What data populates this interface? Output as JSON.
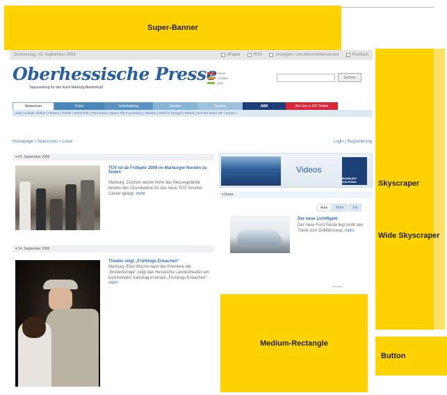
{
  "ads": {
    "super_banner": "Super-Banner",
    "skyscraper": "Skyscraper",
    "wide_skyscraper": "Wide Skyscraper",
    "medium_rectangle": "Medium-Rectangle",
    "button": "Button",
    "color": "#ffd200"
  },
  "site": {
    "date": "Donnerstag, 25. September 2008",
    "top_links": [
      "ePaper",
      "RSS",
      "Anzeigen- und Abonnentenservice",
      "Postfach"
    ],
    "logo": "Oberhessische Presse",
    "tagline": "Tageszeitung für den Kreis Marburg-Biedenkopf",
    "weather": [
      "heute",
      "morgen",
      "jetzt"
    ],
    "search_button": "Suchen",
    "nav_tabs": [
      "Newsroom",
      "Fotos",
      "Unterhaltung",
      "Service",
      "Service",
      "ABR",
      "Bei Uns in OP-Online"
    ],
    "subnav": "Lokal | Lokale Videos | Hessen | Politik | Wirtschaft | Panorama | Sport | DE-Fanzeitung | Wissen | Welt im Spiegel | Rätsel | Schüler lesen OP | Serien |",
    "breadcrumb": "Homepage > Newsroom > Lokal",
    "login": "Login | Registrierung",
    "date1": "24. September 2008",
    "date2": "24. September 2008",
    "article1": {
      "title": "TÜV ist ab Frühjahr 2009 im Marburger Norden zu finden",
      "body": "Marburg. Zeichen wurde hohe das Messegelände bereits den Grundsteine für das neue TÜV Service-Center gelegt.",
      "more": "mehr"
    },
    "article2": {
      "title": "Theater zeigt „Frühlings Erwachen“",
      "body": "Marburg. Eine Woche nach der Premiere der „Bruderkönige“ zeigt das Hessische Landestheater am kommenden Samstag erstmals „Frühlings Erwachen“.",
      "more": "mehr"
    },
    "videos_label": "Videos",
    "dolphins_label": "MARBURG DOLPHINS",
    "home_label": "Home",
    "right_tabs": [
      "Auto",
      "Mehr",
      "Job"
    ],
    "car_title": "Der neue Lichtfigekt",
    "car_body": "Der neue Ford Fiesta fegt nicht den Trend zum Drittfahrzeug.",
    "car_more": "mehr",
    "anzeige": "Anzeige"
  }
}
